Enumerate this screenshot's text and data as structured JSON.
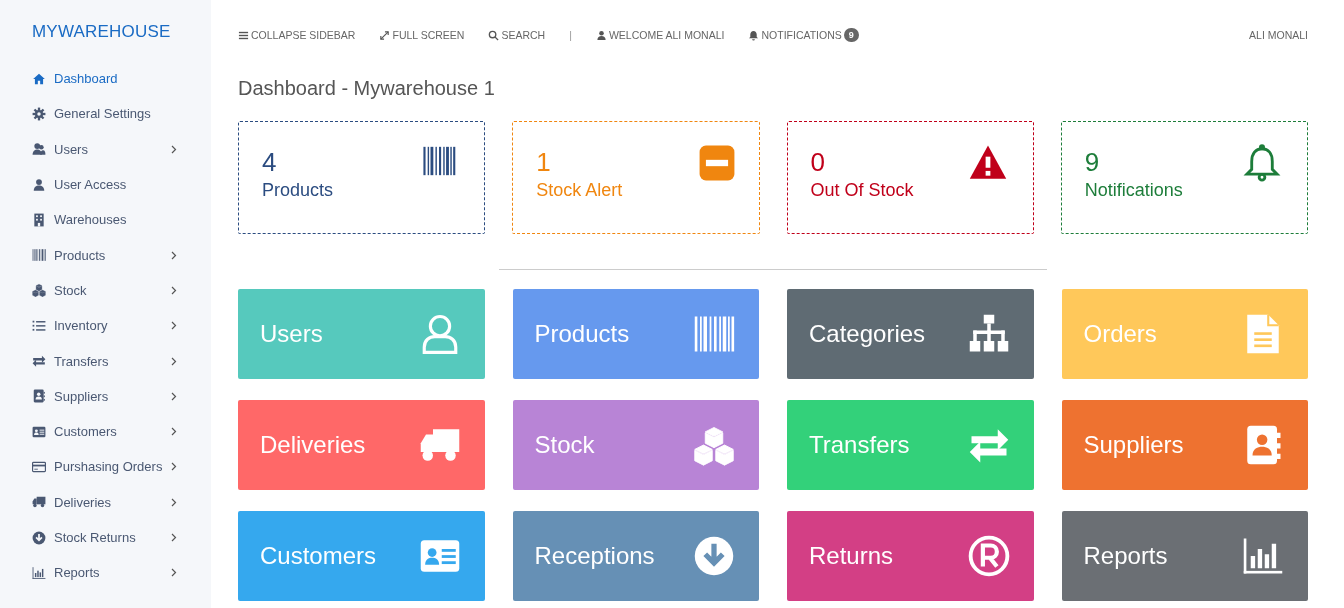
{
  "sidebar": {
    "brand": "MYWAREHOUSE",
    "items": [
      {
        "label": "Dashboard",
        "selected": true,
        "has_submenu": false
      },
      {
        "label": "General Settings",
        "selected": false,
        "has_submenu": false
      },
      {
        "label": "Users",
        "selected": false,
        "has_submenu": true
      },
      {
        "label": "User Access",
        "selected": false,
        "has_submenu": false
      },
      {
        "label": "Warehouses",
        "selected": false,
        "has_submenu": false
      },
      {
        "label": "Products",
        "selected": false,
        "has_submenu": true
      },
      {
        "label": "Stock",
        "selected": false,
        "has_submenu": true
      },
      {
        "label": "Inventory",
        "selected": false,
        "has_submenu": true
      },
      {
        "label": "Transfers",
        "selected": false,
        "has_submenu": true
      },
      {
        "label": "Suppliers",
        "selected": false,
        "has_submenu": true
      },
      {
        "label": "Customers",
        "selected": false,
        "has_submenu": true
      },
      {
        "label": "Purshasing Orders",
        "selected": false,
        "has_submenu": true
      },
      {
        "label": "Deliveries",
        "selected": false,
        "has_submenu": true
      },
      {
        "label": "Stock Returns",
        "selected": false,
        "has_submenu": true
      },
      {
        "label": "Reports",
        "selected": false,
        "has_submenu": true
      }
    ]
  },
  "topbar": {
    "links": [
      "COLLAPSE SIDEBAR",
      "FULL SCREEN",
      "SEARCH",
      "WELCOME ALI MONALI",
      "NOTIFICATIONS"
    ],
    "separator": "|",
    "notification_count": "9",
    "user": "ALI MONALI"
  },
  "page_title": "Dashboard - Mywarehouse 1",
  "stats": [
    {
      "value": "4",
      "label": "Products",
      "color": "#2b4c80"
    },
    {
      "value": "1",
      "label": "Stock Alert",
      "color": "#f0860f"
    },
    {
      "value": "0",
      "label": "Out Of Stock",
      "color": "#c0001a"
    },
    {
      "value": "9",
      "label": "Notifications",
      "color": "#1d7d3a"
    }
  ],
  "tiles": [
    {
      "label": "Users",
      "color": "#56c9bd"
    },
    {
      "label": "Products",
      "color": "#6699ee"
    },
    {
      "label": "Categories",
      "color": "#5f6b73"
    },
    {
      "label": "Orders",
      "color": "#ffc85a"
    },
    {
      "label": "Deliveries",
      "color": "#ff6868"
    },
    {
      "label": "Stock",
      "color": "#b884d6"
    },
    {
      "label": "Transfers",
      "color": "#33d17a"
    },
    {
      "label": "Suppliers",
      "color": "#ee7230"
    },
    {
      "label": "Customers",
      "color": "#35a8ee"
    },
    {
      "label": "Receptions",
      "color": "#6690b5"
    },
    {
      "label": "Returns",
      "color": "#d33f85"
    },
    {
      "label": "Reports",
      "color": "#6b6f74"
    }
  ]
}
